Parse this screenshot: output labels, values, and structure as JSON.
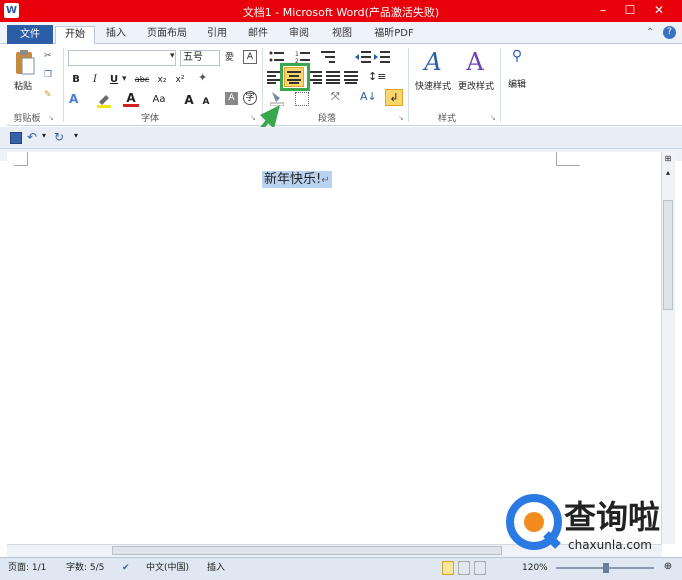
{
  "title_bar": {
    "title": "文档1 - Microsoft Word(产品激活失败)",
    "app_icon": "W",
    "btn_min": "–",
    "btn_max": "☐",
    "btn_close": "✕"
  },
  "tabs": {
    "file": "文件",
    "home": "开始",
    "insert": "插入",
    "layout": "页面布局",
    "references": "引用",
    "mailings": "邮件",
    "review": "审阅",
    "view": "视图",
    "foxit": "福昕PDF"
  },
  "ribbon": {
    "clipboard": {
      "label": "剪贴板",
      "paste": "粘贴"
    },
    "font": {
      "label": "字体",
      "font_name": "",
      "font_size": "五号",
      "bold": "B",
      "italic": "I",
      "underline": "U",
      "strike": "abc",
      "sub": "x₂",
      "sup": "x²",
      "case": "Aa",
      "grow": "A",
      "shrink": "A"
    },
    "paragraph": {
      "label": "段落"
    },
    "styles": {
      "label": "样式",
      "quick_styles": "快速样式",
      "change_styles": "更改样式"
    },
    "editing": {
      "label": "编辑"
    }
  },
  "document": {
    "text": "新年快乐!",
    "para_mark": "↵"
  },
  "status": {
    "page": "页面: 1/1",
    "words": "字数: 5/5",
    "language": "中文(中国)",
    "mode": "插入",
    "zoom": "120%"
  },
  "watermark": {
    "brand": "查询啦",
    "site": "chaxunla.com"
  },
  "colors": {
    "title_red": "#e8000a",
    "file_tab": "#2b5ea7",
    "highlight_green": "#39a74e",
    "selection": "#b9d2ef"
  }
}
